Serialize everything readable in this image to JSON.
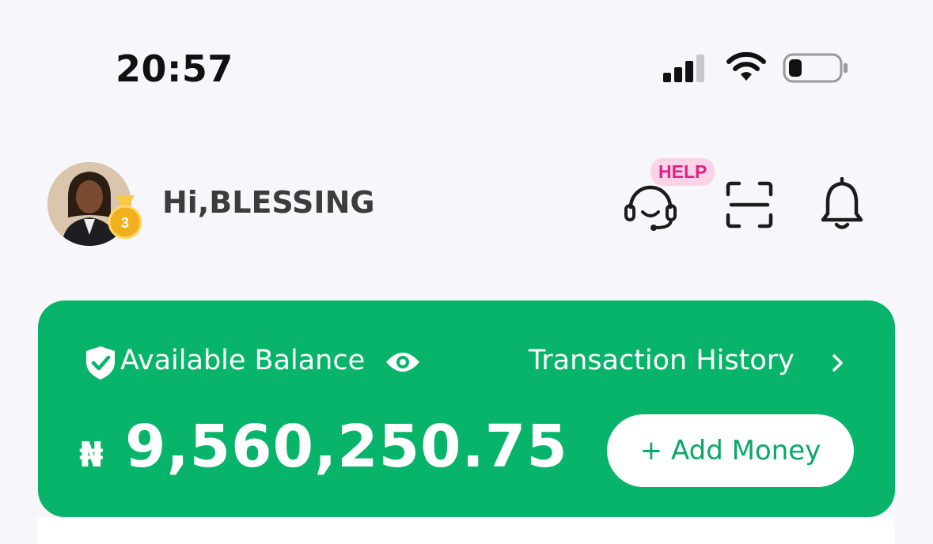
{
  "status_bar": {
    "time": "20:57",
    "signal_icon": "cellular-signal-icon",
    "wifi_icon": "wifi-icon",
    "battery_icon": "battery-low-icon"
  },
  "header": {
    "greeting": "Hi,BLESSING",
    "avatar_icon": "profile-avatar",
    "level_badge": "3",
    "help_badge": "HELP",
    "help_icon": "headset-icon",
    "scan_icon": "scan-icon",
    "bell_icon": "bell-icon"
  },
  "balance_card": {
    "label": "Available Balance",
    "shield_icon": "shield-check-icon",
    "eye_icon": "eye-icon",
    "history_link": "Transaction History",
    "chevron_icon": "chevron-right-icon",
    "currency_symbol": "₦",
    "amount": "9,560,250.75",
    "add_money_label": "+ Add Money",
    "card_color": "#07b46a",
    "button_text_color": "#07a964"
  },
  "colors": {
    "background": "#f7f6fb",
    "help_badge_bg": "#fad4e6",
    "help_badge_text": "#e0218a",
    "medal": "#f2b01e"
  }
}
